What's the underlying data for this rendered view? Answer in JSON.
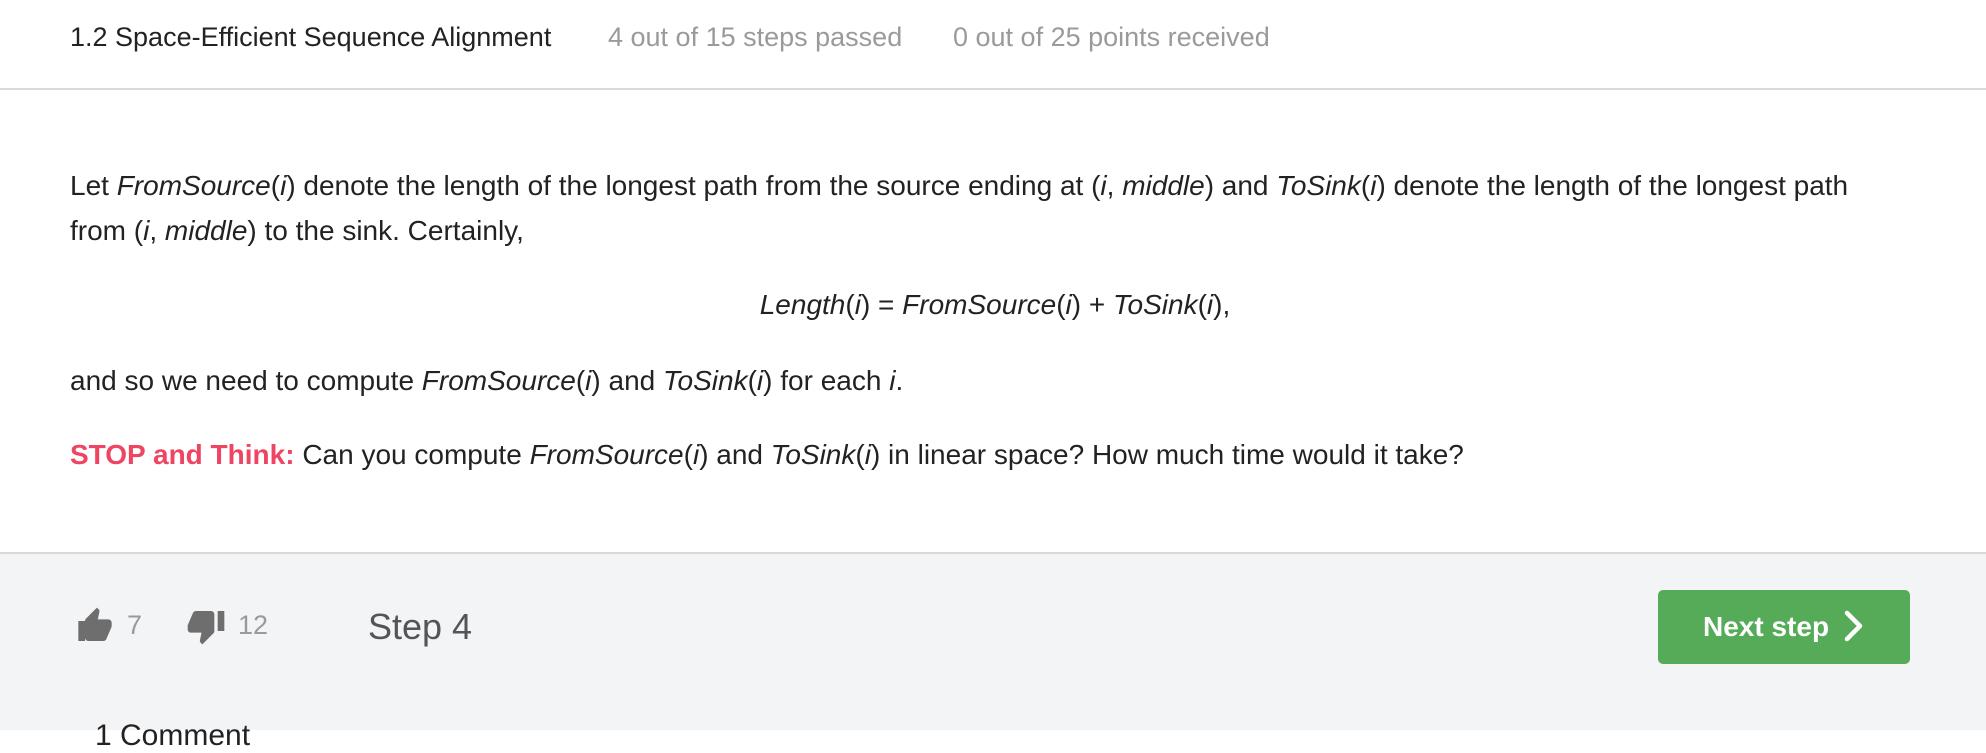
{
  "header": {
    "title": "1.2 Space-Efficient Sequence Alignment",
    "steps_passed": "4 out of 15 steps passed",
    "points_received": "0 out of 25 points  received"
  },
  "body": {
    "p1": {
      "t0": "Let ",
      "fromsource": "FromSource",
      "t1": "(",
      "i1": "i",
      "t2": ") denote the length of the longest path from the source ending at (",
      "i2": "i",
      "t3": ", ",
      "middle": "middle",
      "t4": ") and ",
      "tosink": "ToSink",
      "t5": "(",
      "i3": "i",
      "t6": ") denote the length of the longest path"
    },
    "p2": {
      "t0": "from (",
      "i1": "i",
      "t1": ", ",
      "middle": "middle",
      "t2": ") to the sink. Certainly,"
    },
    "formula": {
      "length": "Length",
      "lp1": "(",
      "i1": "i",
      "rp1": ") = ",
      "fromsource": "FromSource",
      "lp2": "(",
      "i2": "i",
      "rp2": ") + ",
      "tosink": "ToSink",
      "lp3": "(",
      "i3": "i",
      "rp3": "),"
    },
    "p3": {
      "t0": "and so we need to compute ",
      "fromsource": "FromSource",
      "t1": "(",
      "i1": "i",
      "t2": ") and ",
      "tosink": "ToSink",
      "t3": "(",
      "i2": "i",
      "t4": ") for each ",
      "i3": "i",
      "t5": "."
    },
    "stop": {
      "label": "STOP and Think:",
      "t0": " Can you compute ",
      "fromsource": "FromSource",
      "t1": "(",
      "i1": "i",
      "t2": ") and ",
      "tosink": "ToSink",
      "t3": "(",
      "i2": "i",
      "t4": ") in linear space? How much time would it take?"
    }
  },
  "footer": {
    "likes": "7",
    "dislikes": "12",
    "step_label": "Step 4",
    "next_label": "Next step",
    "comments_peek": "1  Comment"
  },
  "colors": {
    "stop_accent": "#ef4462",
    "next_button": "#55ab58",
    "footer_bg": "#f3f4f6"
  },
  "icons": [
    "thumbs-up-icon",
    "thumbs-down-icon",
    "chevron-right-icon"
  ]
}
